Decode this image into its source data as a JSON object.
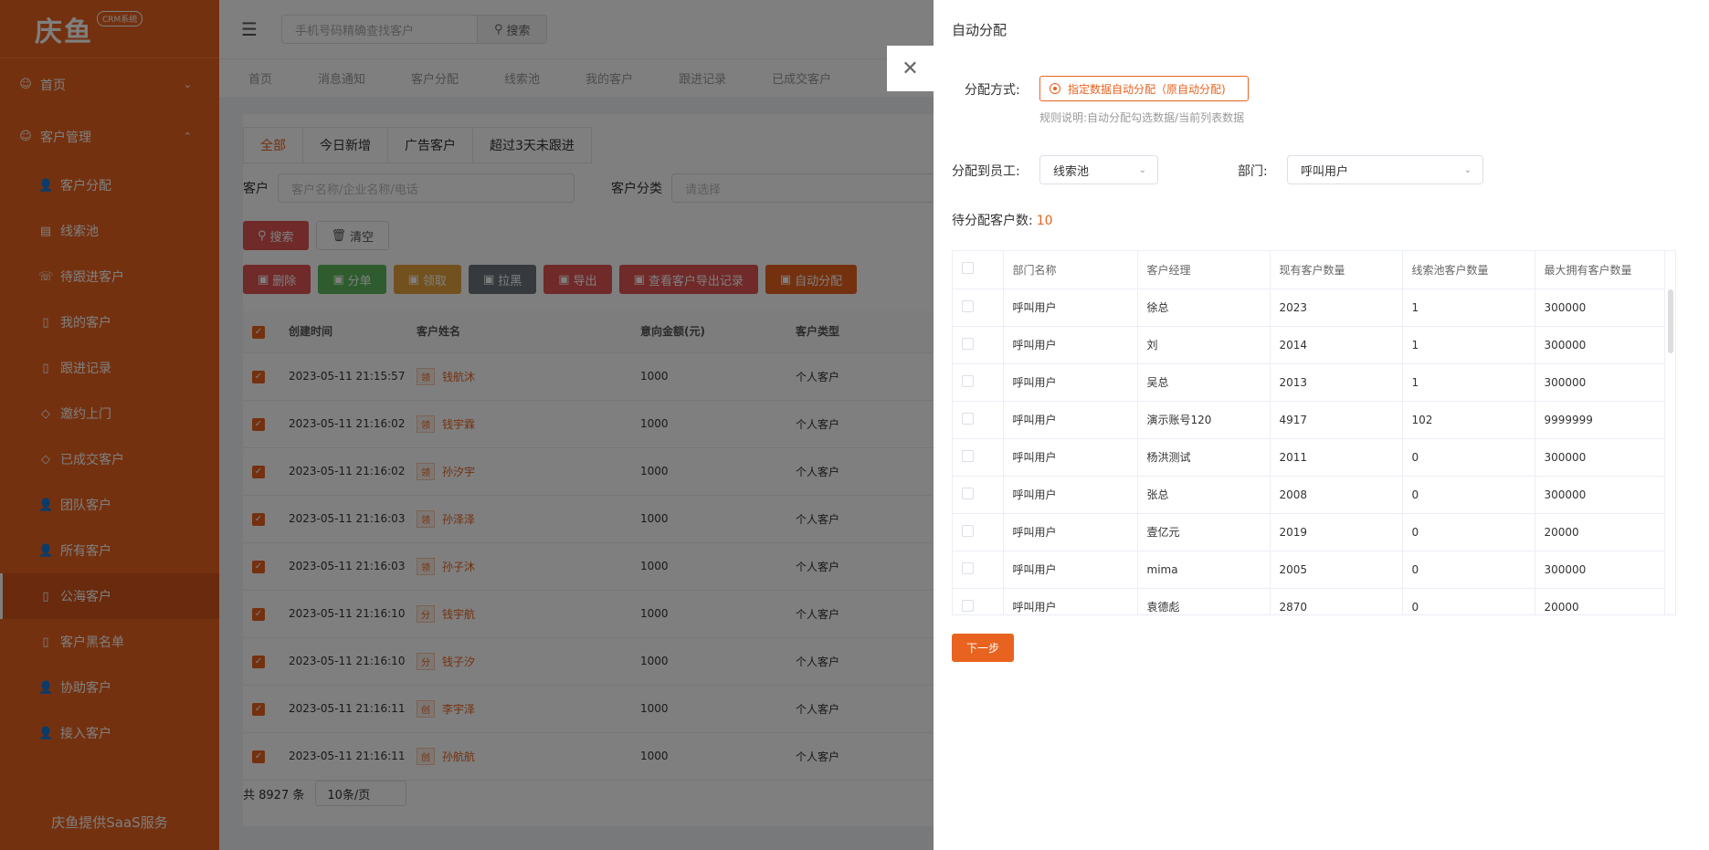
{
  "sidebar": {
    "logo_text": "庆鱼",
    "logo_badge": "CRM系统",
    "home": "首页",
    "customer_mgmt": "客户管理",
    "items": [
      {
        "label": "客户分配",
        "icon": "👤"
      },
      {
        "label": "线索池",
        "icon": "▤"
      },
      {
        "label": "待跟进客户",
        "icon": "☏"
      },
      {
        "label": "我的客户",
        "icon": "▯"
      },
      {
        "label": "跟进记录",
        "icon": "▯"
      },
      {
        "label": "邀约上门",
        "icon": "◇"
      },
      {
        "label": "已成交客户",
        "icon": "◇"
      },
      {
        "label": "团队客户",
        "icon": "👤"
      },
      {
        "label": "所有客户",
        "icon": "👤"
      },
      {
        "label": "公海客户",
        "icon": "▯"
      },
      {
        "label": "客户黑名单",
        "icon": "▯"
      },
      {
        "label": "协助客户",
        "icon": "👤"
      },
      {
        "label": "接入客户",
        "icon": "👤"
      }
    ],
    "active_index": 9,
    "footer": "庆鱼提供SaaS服务"
  },
  "header": {
    "search_placeholder": "手机号码精确查找客户",
    "search_button": "搜索"
  },
  "nav_tabs": [
    "首页",
    "消息通知",
    "客户分配",
    "线索池",
    "我的客户",
    "跟进记录",
    "已成交客户"
  ],
  "main": {
    "sub_tabs": [
      "全部",
      "今日新增",
      "广告客户",
      "超过3天未跟进"
    ],
    "filter_customer_label": "客户",
    "filter_customer_placeholder": "客户名称/企业名称/电话",
    "filter_category_label": "客户分类",
    "filter_category_placeholder": "请选择",
    "search_btn": "搜索",
    "clear_btn": "清空",
    "actions": [
      {
        "label": "删除",
        "color": "#e05552"
      },
      {
        "label": "分单",
        "color": "#5cb85c"
      },
      {
        "label": "领取",
        "color": "#e6a23c"
      },
      {
        "label": "拉黑",
        "color": "#6c757d"
      },
      {
        "label": "导出",
        "color": "#e05552"
      },
      {
        "label": "查看客户导出记录",
        "color": "#e05552"
      },
      {
        "label": "自动分配",
        "color": "#e8631f"
      }
    ],
    "columns": [
      "创建时间",
      "客户姓名",
      "意向金额(元)",
      "客户类型"
    ],
    "rows": [
      {
        "time": "2023-05-11 21:15:57",
        "tag": "领",
        "name": "钱航沐",
        "amount": "1000",
        "type": "个人客户"
      },
      {
        "time": "2023-05-11 21:16:02",
        "tag": "领",
        "name": "钱宇霖",
        "amount": "1000",
        "type": "个人客户"
      },
      {
        "time": "2023-05-11 21:16:02",
        "tag": "领",
        "name": "孙汐宇",
        "amount": "1000",
        "type": "个人客户"
      },
      {
        "time": "2023-05-11 21:16:03",
        "tag": "领",
        "name": "孙泽泽",
        "amount": "1000",
        "type": "个人客户"
      },
      {
        "time": "2023-05-11 21:16:03",
        "tag": "领",
        "name": "孙子沐",
        "amount": "1000",
        "type": "个人客户"
      },
      {
        "time": "2023-05-11 21:16:10",
        "tag": "分",
        "name": "钱宇航",
        "amount": "1000",
        "type": "个人客户"
      },
      {
        "time": "2023-05-11 21:16:10",
        "tag": "分",
        "name": "钱子汐",
        "amount": "1000",
        "type": "个人客户"
      },
      {
        "time": "2023-05-11 21:16:11",
        "tag": "创",
        "name": "李宇泽",
        "amount": "1000",
        "type": "个人客户"
      },
      {
        "time": "2023-05-11 21:16:11",
        "tag": "创",
        "name": "孙航航",
        "amount": "1000",
        "type": "个人客户"
      }
    ],
    "total": "共 8927 条",
    "page_size": "10条/页"
  },
  "drawer": {
    "title": "自动分配",
    "mode_label": "分配方式:",
    "mode_option": "指定数据自动分配（原自动分配)",
    "rule_text": "规则说明:自动分配勾选数据/当前列表数据",
    "assign_label": "分配到员工:",
    "assign_value": "线索池",
    "dept_label": "部门:",
    "dept_value": "呼叫用户",
    "pending_label": "待分配客户数:",
    "pending_count": "10",
    "columns": [
      "部门名称",
      "客户经理",
      "现有客户数量",
      "线索池客户数量",
      "最大拥有客户数量"
    ],
    "rows": [
      {
        "dept": "呼叫用户",
        "manager": "徐总",
        "current": "2023",
        "pool": "1",
        "max": "300000"
      },
      {
        "dept": "呼叫用户",
        "manager": "刘",
        "current": "2014",
        "pool": "1",
        "max": "300000"
      },
      {
        "dept": "呼叫用户",
        "manager": "吴总",
        "current": "2013",
        "pool": "1",
        "max": "300000"
      },
      {
        "dept": "呼叫用户",
        "manager": "演示账号120",
        "current": "4917",
        "pool": "102",
        "max": "9999999"
      },
      {
        "dept": "呼叫用户",
        "manager": "杨洪测试",
        "current": "2011",
        "pool": "0",
        "max": "300000"
      },
      {
        "dept": "呼叫用户",
        "manager": "张总",
        "current": "2008",
        "pool": "0",
        "max": "300000"
      },
      {
        "dept": "呼叫用户",
        "manager": "壹亿元",
        "current": "2019",
        "pool": "0",
        "max": "20000"
      },
      {
        "dept": "呼叫用户",
        "manager": "mima",
        "current": "2005",
        "pool": "0",
        "max": "300000"
      },
      {
        "dept": "呼叫用户",
        "manager": "袁德彪",
        "current": "2870",
        "pool": "0",
        "max": "20000"
      }
    ],
    "next_button": "下一步"
  },
  "colors": {
    "brand": "#e8631f",
    "overlay": "rgba(0,0,0,0.5)"
  }
}
